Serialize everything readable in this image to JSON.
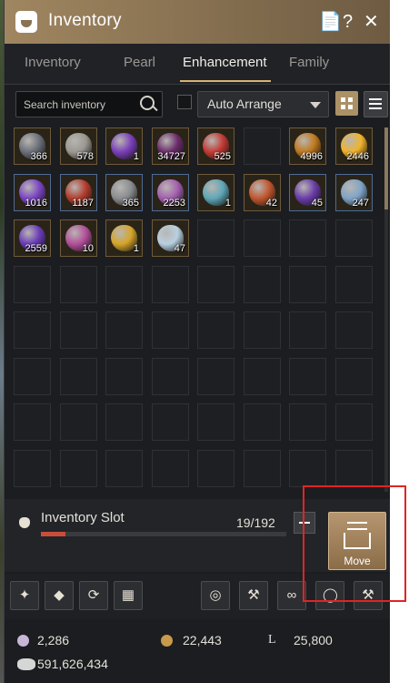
{
  "window": {
    "title": "Inventory"
  },
  "tabs": [
    {
      "label": "Inventory",
      "active": false
    },
    {
      "label": "Pearl",
      "active": false
    },
    {
      "label": "Enhancement",
      "active": true
    },
    {
      "label": "Family",
      "active": false
    }
  ],
  "search": {
    "placeholder": "Search inventory"
  },
  "auto_arrange": {
    "label": "Auto Arrange",
    "checked": false
  },
  "view_modes": [
    "grid-view-icon",
    "list-view-icon"
  ],
  "items": [
    {
      "qty": "366",
      "color": "#6b6f78",
      "frame": "gold"
    },
    {
      "qty": "578",
      "color": "#9a9890",
      "frame": "gold"
    },
    {
      "qty": "1",
      "color": "#7a3fb8",
      "frame": "gold"
    },
    {
      "qty": "34727",
      "color": "#6b2c6a",
      "frame": "gold"
    },
    {
      "qty": "525",
      "color": "#c23a34",
      "frame": "gold"
    },
    {
      "qty": "",
      "color": "",
      "frame": "empty"
    },
    {
      "qty": "4996",
      "color": "#c0791e",
      "frame": "gold"
    },
    {
      "qty": "2446",
      "color": "#f2b32a",
      "frame": "gold"
    },
    {
      "qty": "1016",
      "color": "#7b45c4",
      "frame": "blue"
    },
    {
      "qty": "1187",
      "color": "#b33d2e",
      "frame": "blue"
    },
    {
      "qty": "365",
      "color": "#8a8c90",
      "frame": "blue"
    },
    {
      "qty": "2253",
      "color": "#a45fb0",
      "frame": "blue"
    },
    {
      "qty": "1",
      "color": "#5fa7b8",
      "frame": "gold"
    },
    {
      "qty": "42",
      "color": "#c0562e",
      "frame": "gold"
    },
    {
      "qty": "45",
      "color": "#6a3ca8",
      "frame": "blue"
    },
    {
      "qty": "247",
      "color": "#7fa4c8",
      "frame": "blue"
    },
    {
      "qty": "2559",
      "color": "#6a3cb8",
      "frame": "gold"
    },
    {
      "qty": "10",
      "color": "#b34f9a",
      "frame": "gold"
    },
    {
      "qty": "1",
      "color": "#d6a52a",
      "frame": "gold"
    },
    {
      "qty": "47",
      "color": "#b8d0e0",
      "frame": "gold"
    }
  ],
  "grid": {
    "columns": 8,
    "rows": 8
  },
  "slots": {
    "label": "Inventory Slot",
    "count": "19/192",
    "fill_fraction": 0.099
  },
  "move": {
    "label": "Move"
  },
  "tools_left": [
    "enhance-wand-icon",
    "crystal-icon",
    "recycle-icon",
    "grid-icon"
  ],
  "tools_right": [
    "compass-icon",
    "hammer-icon",
    "knot-icon",
    "ring-icon",
    "craft-hammer-icon"
  ],
  "currency": {
    "pearl": "2,286",
    "coin": "22,443",
    "loyalty": "25,800",
    "silver": "591,626,434"
  },
  "colors": {
    "accent": "#ab9165",
    "title_bar": "#8a7353",
    "progress": "#c94e3a",
    "highlight": "#e02424"
  }
}
